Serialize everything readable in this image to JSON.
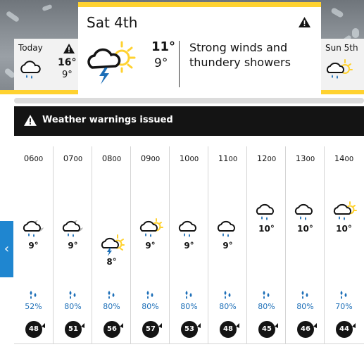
{
  "days": {
    "today": {
      "label": "Today",
      "high": "16°",
      "low": "9°",
      "icon": "light-rain-cloud-icon"
    },
    "selected": {
      "day": "Sat",
      "date": "4th",
      "high": "11°",
      "low": "9°",
      "description": "Strong winds and thundery showers",
      "icon": "thundery-shower-icon"
    },
    "next": {
      "label": "Sun 5th",
      "icon": "sunny-intervals-rain-icon"
    }
  },
  "warnings": {
    "label": "Weather warnings issued",
    "icon": "warning-triangle-icon"
  },
  "colors": {
    "accent": "#ffd230",
    "warning_bar": "#141414",
    "rain": "#1d6fb8",
    "nav": "#1f86d0"
  },
  "hours": [
    {
      "time_h": "06",
      "time_m": "00",
      "temp": "9°",
      "icon": "night-rain-icon",
      "rain": "52%",
      "wind": "48"
    },
    {
      "time_h": "07",
      "time_m": "00",
      "temp": "9°",
      "icon": "night-rain-icon",
      "rain": "80%",
      "wind": "51"
    },
    {
      "time_h": "08",
      "time_m": "00",
      "temp": "8°",
      "icon": "thundery-shower-icon",
      "rain": "80%",
      "wind": "56"
    },
    {
      "time_h": "09",
      "time_m": "00",
      "temp": "9°",
      "icon": "sunny-rain-icon",
      "rain": "80%",
      "wind": "57"
    },
    {
      "time_h": "10",
      "time_m": "00",
      "temp": "9°",
      "icon": "light-rain-cloud-icon",
      "rain": "80%",
      "wind": "53"
    },
    {
      "time_h": "11",
      "time_m": "00",
      "temp": "9°",
      "icon": "light-rain-cloud-icon",
      "rain": "80%",
      "wind": "48"
    },
    {
      "time_h": "12",
      "time_m": "00",
      "temp": "10°",
      "icon": "light-rain-cloud-icon",
      "rain": "80%",
      "wind": "45"
    },
    {
      "time_h": "13",
      "time_m": "00",
      "temp": "10°",
      "icon": "light-rain-cloud-icon",
      "rain": "80%",
      "wind": "46"
    },
    {
      "time_h": "14",
      "time_m": "00",
      "temp": "10°",
      "icon": "sunny-rain-icon",
      "rain": "70%",
      "wind": "44"
    }
  ]
}
